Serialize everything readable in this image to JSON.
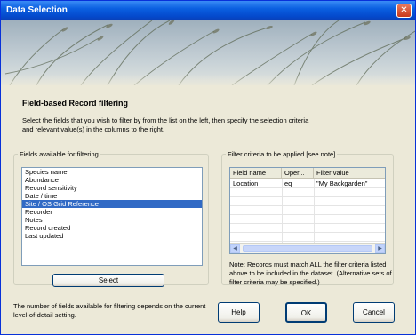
{
  "window": {
    "title": "Data Selection",
    "close_glyph": "✕"
  },
  "header": {
    "title": "Field-based Record filtering",
    "intro": "Select the fields that you wish to filter by from the list on the left, then specify the selection criteria and relevant value(s) in the columns to the right."
  },
  "fields_panel": {
    "legend": "Fields available for filtering",
    "items": [
      {
        "label": "Species name",
        "selected": false
      },
      {
        "label": "Abundance",
        "selected": false
      },
      {
        "label": "Record sensitivity",
        "selected": false
      },
      {
        "label": "Date / time",
        "selected": false
      },
      {
        "label": "Site / OS Grid Reference",
        "selected": true
      },
      {
        "label": "Recorder",
        "selected": false
      },
      {
        "label": "Notes",
        "selected": false
      },
      {
        "label": "Record created",
        "selected": false
      },
      {
        "label": "Last updated",
        "selected": false
      }
    ],
    "select_button": "Select"
  },
  "criteria_panel": {
    "legend": "Filter criteria to be applied [see note]",
    "columns": [
      "Field name",
      "Oper...",
      "Filter value"
    ],
    "rows": [
      {
        "field": "Location",
        "operator": "eq",
        "value": "\"My Backgarden\""
      }
    ],
    "note": "Note: Records must match ALL the filter criteria listed above to be included in the dataset. (Alternative sets of filter criteria may be specified.)"
  },
  "footer": {
    "note": "The number of fields available for filtering depends on the current level-of-detail setting.",
    "help_button": "Help",
    "ok_button": "OK",
    "cancel_button": "Cancel"
  },
  "icons": {
    "scroll_left": "◀",
    "scroll_right": "▶"
  },
  "colors": {
    "titlebar": "#0a5fe0",
    "selection": "#316ac5",
    "dialog_bg": "#ece9d8"
  }
}
